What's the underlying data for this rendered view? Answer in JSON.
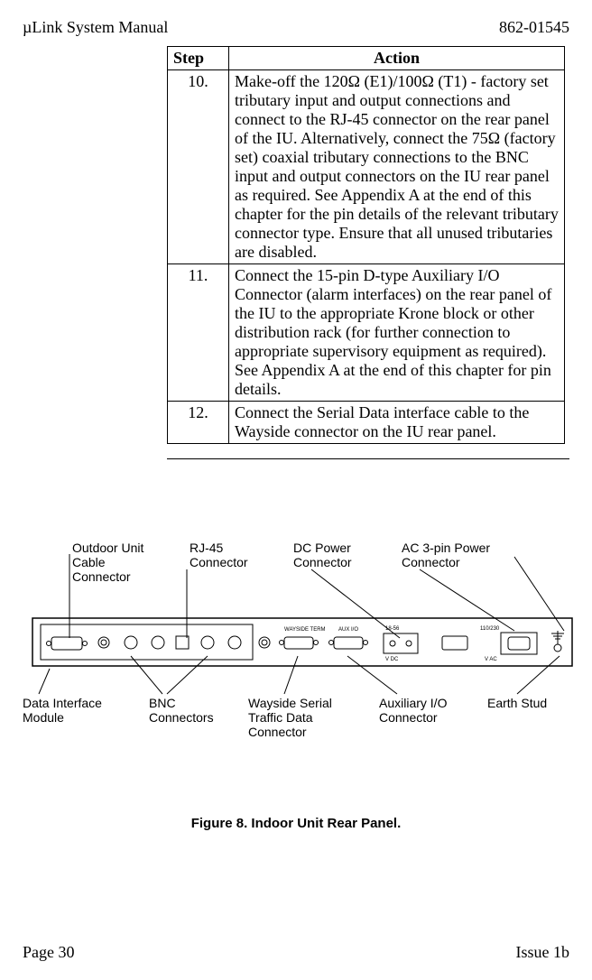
{
  "header": {
    "left": "µLink System Manual",
    "right": "862-01545"
  },
  "table": {
    "head": {
      "step": "Step",
      "action": "Action"
    },
    "rows": [
      {
        "step": "10.",
        "action": "Make-off the 120Ω (E1)/100Ω (T1) - factory set tributary input and output connections and connect to the RJ-45 connector on the rear panel of the IU.  Alternatively, connect the 75Ω (factory set) coaxial tributary connections to the BNC input and output connectors on the IU rear panel as required.  See Appendix A at the end of this chapter for the pin details of the relevant tributary connector type.  Ensure that all unused tributaries are disabled."
      },
      {
        "step": "11.",
        "action": "Connect the 15-pin D-type Auxiliary I/O Connector (alarm interfaces) on the rear panel of the IU to the appropriate Krone block or other distribution rack (for further connection to appropriate supervisory equipment as required).  See Appendix A at the end of this chapter for pin details."
      },
      {
        "step": "12.",
        "action": "Connect the Serial Data interface cable to the Wayside connector on the IU rear panel."
      }
    ]
  },
  "labels_top": {
    "outdoor": "Outdoor Unit\nCable\nConnector",
    "rj45": "RJ-45\nConnector",
    "dc": "DC Power\nConnector",
    "ac": "AC 3-pin Power\nConnector"
  },
  "labels_bottom": {
    "dim": "Data Interface\nModule",
    "bnc": "BNC\nConnectors",
    "wayside": "Wayside Serial\nTraffic Data\nConnector",
    "auxio": "Auxiliary I/O\nConnector",
    "earth": "Earth Stud"
  },
  "figure_caption": "Figure 8.  Indoor Unit Rear Panel.",
  "footer": {
    "left": "Page 30",
    "right": "Issue 1b"
  }
}
